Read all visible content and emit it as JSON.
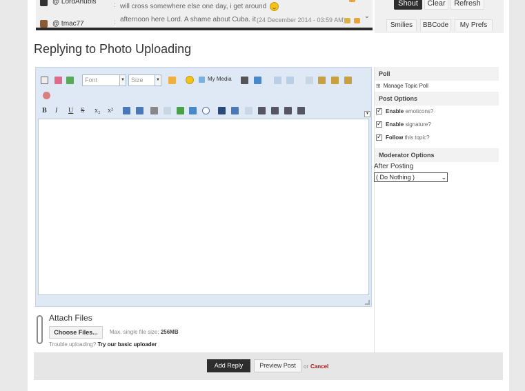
{
  "shoutbox": {
    "rows": [
      {
        "user": "@ LordAnubis",
        "message": "will cross somewhere else one day, i get around",
        "date": ""
      },
      {
        "user": "@ tmac77",
        "message": "afternoon here Lord. A shame about Cuba. it",
        "date": "(24 December 2014 - 03:59 AM)"
      }
    ],
    "buttons": {
      "shout": "Shout",
      "clear": "Clear",
      "refresh": "Refresh"
    },
    "tabs": [
      "Smilies",
      "BBCode",
      "My Prefs"
    ]
  },
  "page_title": "Replying to Photo Uploading",
  "editor": {
    "font_placeholder": "Font",
    "size_placeholder": "Size",
    "my_media": "My Media",
    "format_buttons": [
      "B",
      "I",
      "U",
      "S",
      "x₂",
      "x²"
    ]
  },
  "attach": {
    "title": "Attach Files",
    "choose_button": "Choose Files...",
    "max_size_label": "Max. single file size:",
    "max_size_value": "256MB",
    "trouble_text": "Trouble uploading?",
    "basic_uploader": "Try our basic uploader"
  },
  "sidebar": {
    "poll_head": "Poll",
    "manage_poll": "Manage Topic Poll",
    "post_options_head": "Post Options",
    "options": [
      {
        "bold": "Enable",
        "rest": " emoticons?",
        "checked": true
      },
      {
        "bold": "Enable",
        "rest": " signature?",
        "checked": true
      },
      {
        "bold": "Follow",
        "rest": " this topic?",
        "checked": true
      }
    ],
    "moderator_head": "Moderator Options",
    "after_posting": "After Posting",
    "after_posting_value": "( Do Nothing )"
  },
  "footer": {
    "add_reply": "Add Reply",
    "preview_post": "Preview Post",
    "or": "or",
    "cancel": "Cancel"
  },
  "colors": {
    "dark_button": "#2d2d2d",
    "cancel": "#a31818",
    "editor_bg": "#dfe9f5"
  }
}
